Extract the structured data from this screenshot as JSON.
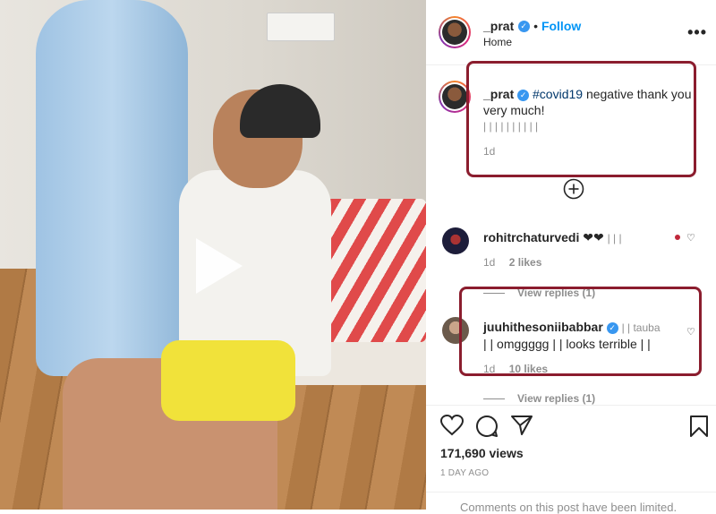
{
  "post": {
    "username": "_prat",
    "follow_label": "Follow",
    "location": "Home",
    "more_icon": "more-icon",
    "caption": {
      "username": "_prat",
      "hashtag": "#covid19",
      "text": " negative thank you very much!",
      "emoji_row": "| | | | | | | | | |",
      "age": "1d"
    },
    "load_more_icon": "plus-circle-icon"
  },
  "comments": [
    {
      "username": "rohitrchaturvedi",
      "text": "❤❤",
      "extra": "| | |",
      "age": "1d",
      "likes": "2 likes",
      "view_replies": "View replies (1)"
    },
    {
      "username": "juuhithesoniibabbar",
      "text_line1": "| | tauba",
      "text_line2": "| | omggggg | | looks terrible | |",
      "age": "1d",
      "likes": "10 likes",
      "view_replies": "View replies (1)"
    }
  ],
  "footer": {
    "views": "171,690 views",
    "ago": "1 DAY AGO",
    "limited": "Comments on this post have been limited."
  },
  "colors": {
    "highlight_border": "#8b1d2e",
    "verified": "#3897f0",
    "follow": "#0095f6"
  }
}
